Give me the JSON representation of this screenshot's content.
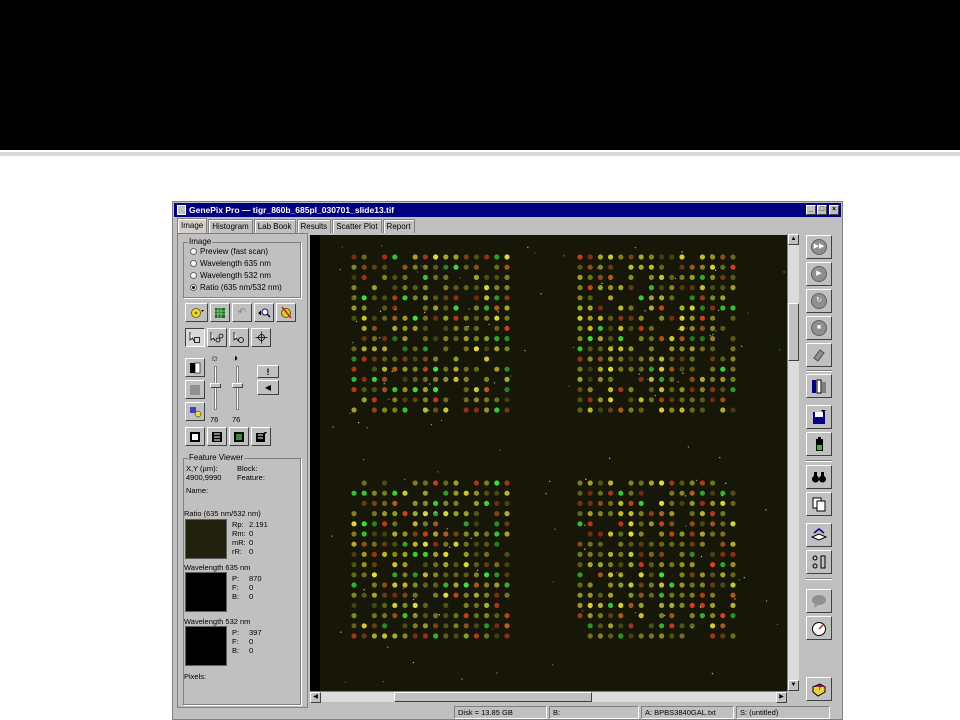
{
  "window": {
    "title": "GenePix Pro — tigr_860b_685pl_030701_slide13.tif",
    "buttons": [
      "_",
      "□",
      "×"
    ]
  },
  "tabs": [
    {
      "label": "Image",
      "active": true
    },
    {
      "label": "Histogram",
      "active": false
    },
    {
      "label": "Lab Book",
      "active": false
    },
    {
      "label": "Results",
      "active": false
    },
    {
      "label": "Scatter Plot",
      "active": false
    },
    {
      "label": "Report",
      "active": false
    }
  ],
  "image_group": {
    "title": "Image",
    "options": [
      {
        "label": "Preview (fast scan)",
        "selected": false
      },
      {
        "label": "Wavelength 635 nm",
        "selected": false
      },
      {
        "label": "Wavelength 532 nm",
        "selected": false
      },
      {
        "label": "Ratio (635 nm/532 nm)",
        "selected": true
      }
    ]
  },
  "sliders": {
    "brightness_value": "76",
    "contrast_value": "76",
    "brightness_icon": "☼",
    "contrast_icon": "◑",
    "brightness_level": 0.38,
    "contrast_level": 0.38
  },
  "feature_viewer": {
    "title": "Feature Viewer",
    "xy_label": "X,Y (µm):",
    "xy_value": "4900,9990",
    "block_label": "Block:",
    "feature_label": "Feature:",
    "name_label": "Name:",
    "ratio": {
      "title": "Ratio (635 nm/532 nm)",
      "stats": [
        {
          "label": "Rp:",
          "value": "2.191"
        },
        {
          "label": "Rm:",
          "value": "0"
        },
        {
          "label": "mR:",
          "value": "0"
        },
        {
          "label": "rR:",
          "value": "0"
        }
      ]
    },
    "w635": {
      "title": "Wavelength 635 nm",
      "stats": [
        {
          "label": "P:",
          "value": "870"
        },
        {
          "label": "F:",
          "value": "0"
        },
        {
          "label": "B:",
          "value": "0"
        }
      ]
    },
    "w532": {
      "title": "Wavelength 532 nm",
      "stats": [
        {
          "label": "P:",
          "value": "397"
        },
        {
          "label": "F:",
          "value": "0"
        },
        {
          "label": "B:",
          "value": "0"
        }
      ]
    },
    "pixels_label": "Pixels:"
  },
  "status": {
    "disk": "Disk = 13.85 GB",
    "b": "B:",
    "a": "A: BPBS3840GAL.txt",
    "s": "S: (untitled)"
  },
  "toolbar_icons": [
    "fast-forward-icon",
    "play-icon",
    "repeat-scan-icon",
    "stop-icon",
    "eraser-icon",
    "library-icon",
    "save-icon",
    "battery-icon",
    "binoculars-icon",
    "copy-icon",
    "layers-icon",
    "align-icon",
    "chat-icon",
    "gauge-icon",
    "help-book-icon"
  ],
  "colors": {
    "titlebar": "#000080",
    "panel": "#c0c0c0",
    "scan_background": "#161708",
    "spot_green": "#3ee63e",
    "spot_yellow": "#e8e03a",
    "spot_red": "#d8401e"
  }
}
